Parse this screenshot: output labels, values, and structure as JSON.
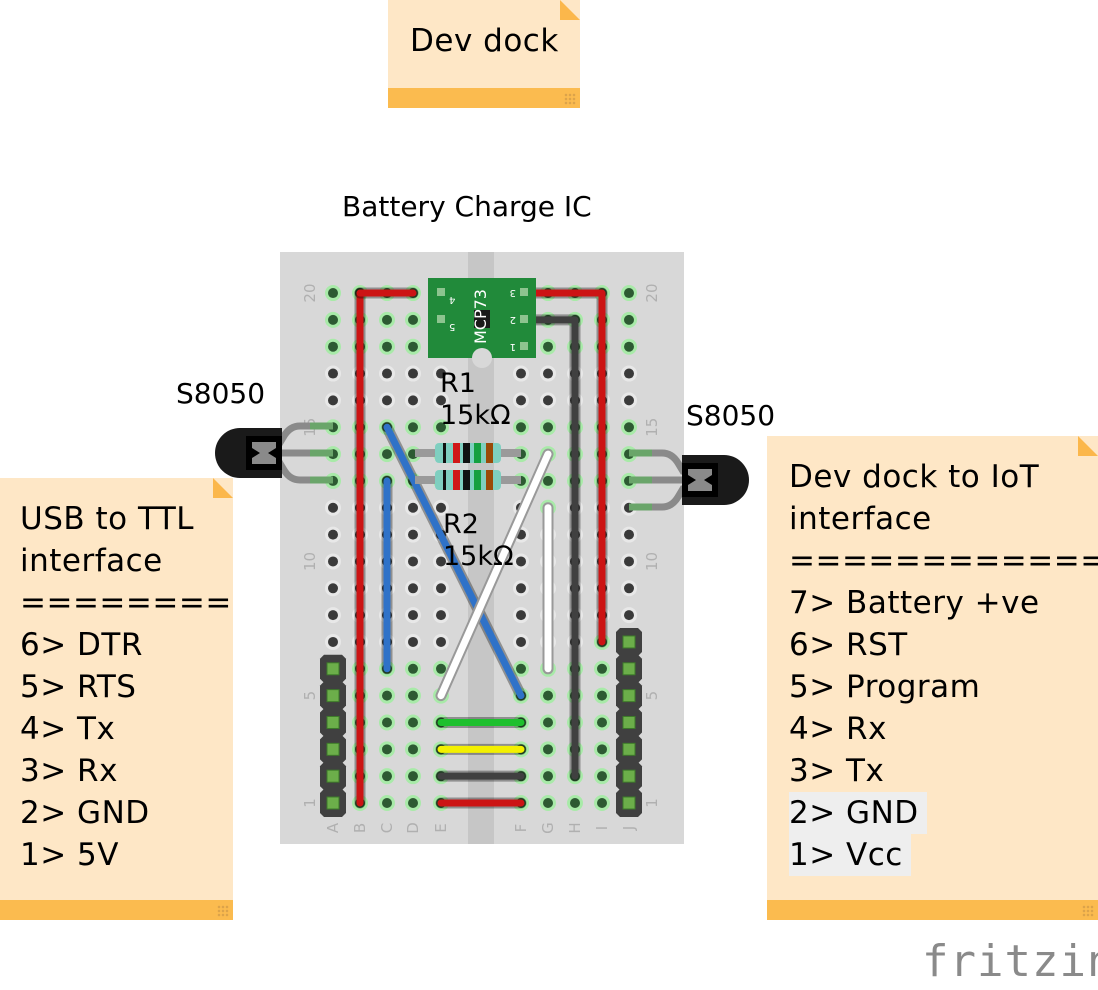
{
  "notes": {
    "dev_dock": {
      "title": "Dev dock"
    },
    "usb_ttl": {
      "lines": [
        "USB to TTL",
        "interface",
        "========",
        "6> DTR",
        "5> RTS",
        "4> Tx",
        "3> Rx",
        "2> GND",
        "1> 5V"
      ]
    },
    "iot": {
      "lines": [
        "Dev dock to IoT",
        "interface",
        "=============",
        "7> Battery +ve",
        "6> RST",
        "5> Program",
        "4> Rx",
        "3> Tx",
        "2> GND",
        "1> Vcc"
      ]
    }
  },
  "labels": {
    "ic_title": "Battery Charge IC",
    "transistor_left": "S8050",
    "transistor_right": "S8050",
    "r1_name": "R1",
    "r1_value": "15kΩ",
    "r2_name": "R2",
    "r2_value": "15kΩ",
    "ic_part": "MCP73",
    "ic_pins_left": [
      "4",
      "5"
    ],
    "ic_pins_right": [
      "3",
      "2",
      "1"
    ]
  },
  "breadboard": {
    "columns": [
      "A",
      "B",
      "C",
      "D",
      "E",
      "F",
      "G",
      "H",
      "I",
      "J"
    ],
    "row_labels": [
      "20",
      "15",
      "10",
      "5",
      "1"
    ],
    "rows": 20,
    "wires": [
      {
        "color": "#cc1414",
        "path": [
          [
            "B",
            20
          ],
          [
            "B",
            1
          ]
        ]
      },
      {
        "color": "#cc1414",
        "path": [
          [
            "B",
            20
          ],
          [
            "D",
            20
          ]
        ]
      },
      {
        "color": "#cc1414",
        "path": [
          [
            "F",
            20
          ],
          [
            "I",
            20
          ],
          [
            "I",
            7
          ]
        ]
      },
      {
        "color": "#404040",
        "path": [
          [
            "F",
            19
          ],
          [
            "H",
            19
          ],
          [
            "H",
            2
          ]
        ]
      },
      {
        "color": "#2f72c8",
        "path": [
          [
            "C",
            15
          ],
          [
            "F",
            5
          ]
        ]
      },
      {
        "color": "#2f72c8",
        "path": [
          [
            "C",
            13
          ],
          [
            "C",
            6
          ]
        ]
      },
      {
        "color": "#ffffff",
        "path": [
          [
            "G",
            14
          ],
          [
            "E",
            5
          ]
        ]
      },
      {
        "color": "#ffffff",
        "path": [
          [
            "G",
            12
          ],
          [
            "G",
            6
          ]
        ]
      },
      {
        "color": "#1ec02e",
        "path": [
          [
            "E",
            4
          ],
          [
            "F",
            4
          ]
        ]
      },
      {
        "color": "#f3f000",
        "path": [
          [
            "E",
            3
          ],
          [
            "F",
            3
          ]
        ]
      },
      {
        "color": "#404040",
        "path": [
          [
            "E",
            2
          ],
          [
            "F",
            2
          ]
        ]
      },
      {
        "color": "#cc1414",
        "path": [
          [
            "E",
            1
          ],
          [
            "F",
            1
          ]
        ]
      }
    ],
    "header_left_pins": 6,
    "header_right_pins": 7
  },
  "branding": {
    "logo": "fritzing"
  }
}
